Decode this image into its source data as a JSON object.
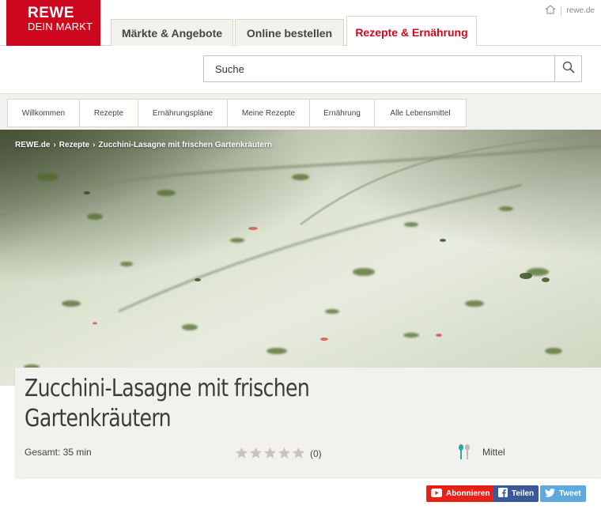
{
  "logo": {
    "line1": "REWE",
    "line2": "DEIN MARKT"
  },
  "header": {
    "tabs": [
      {
        "label": "Märkte & Angebote"
      },
      {
        "label": "Online bestellen"
      },
      {
        "label": "Rezepte & Ernährung"
      }
    ],
    "site_link": "rewe.de"
  },
  "search": {
    "placeholder": "Suche"
  },
  "subnav": {
    "items": [
      {
        "label": "Willkommen"
      },
      {
        "label": "Rezepte"
      },
      {
        "label": "Ernährungspläne"
      },
      {
        "label": "Meine Rezepte"
      },
      {
        "label": "Ernährung"
      },
      {
        "label": "Alle Lebensmittel"
      }
    ]
  },
  "breadcrumb": {
    "items": [
      "REWE.de",
      "Rezepte",
      "Zucchini-Lasagne mit frischen Gartenkräutern"
    ],
    "separator": "›"
  },
  "recipe": {
    "title": "Zucchini-Lasagne mit frischen Gartenkräutern",
    "total_time": "Gesamt: 35 min",
    "rating_count": "(0)",
    "rating_value": 0,
    "difficulty": "Mittel"
  },
  "social": {
    "youtube": "Abonnieren",
    "facebook": "Teilen",
    "twitter": "Tweet"
  },
  "colors": {
    "brand_red": "#cc071e",
    "background": "#f3f1ee",
    "youtube": "#e62117",
    "facebook": "#3b5998",
    "twitter": "#5ea9dd",
    "difficulty_icon": "#2aa8a0"
  }
}
